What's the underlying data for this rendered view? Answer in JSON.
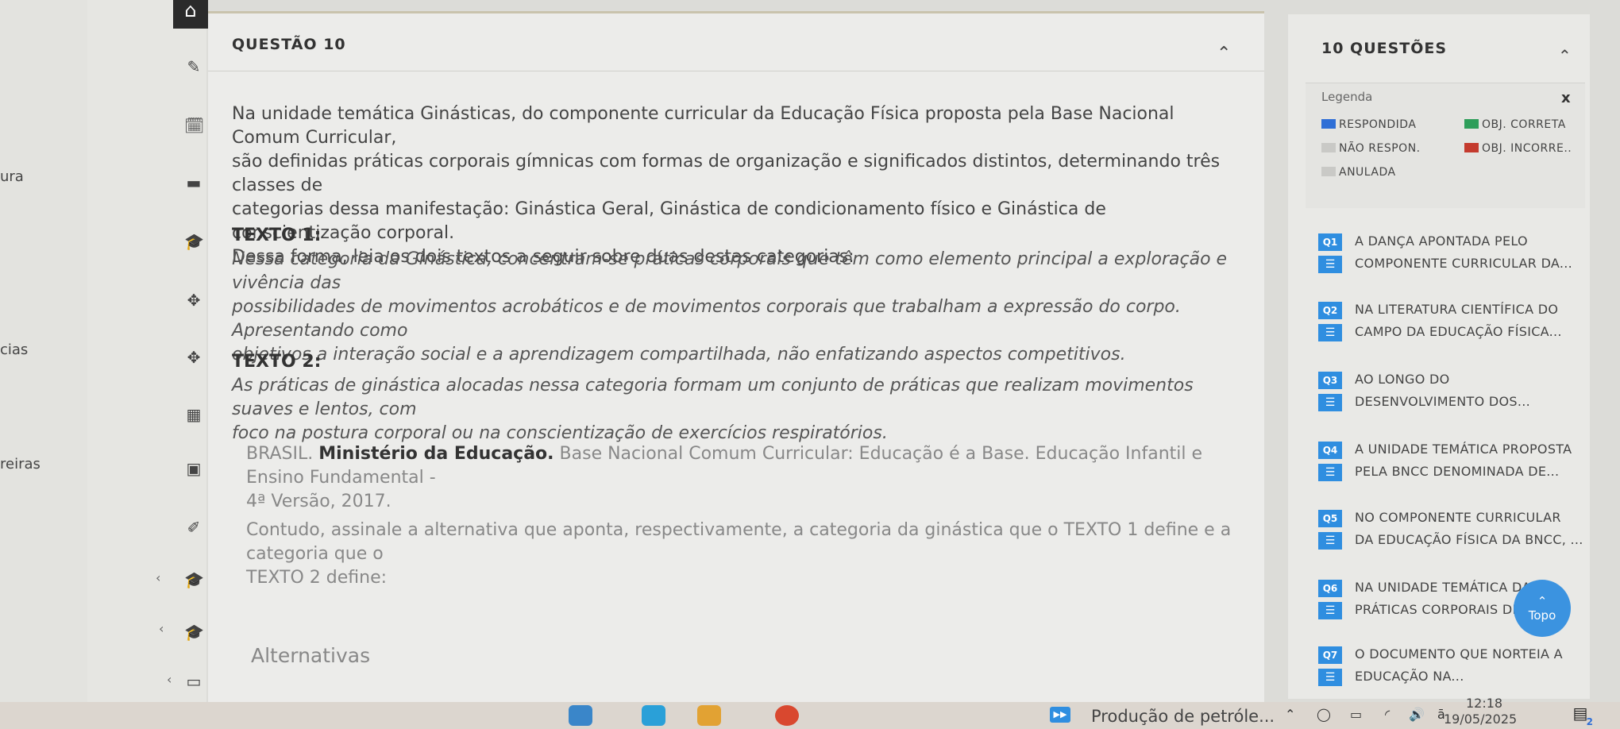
{
  "nav": {
    "labels": [
      "ura",
      "cias",
      "reiras"
    ]
  },
  "question": {
    "title": "QUESTÃO 10",
    "intro": [
      "Na unidade temática Ginásticas, do componente curricular da Educação Física proposta pela Base Nacional Comum Curricular,",
      "são definidas práticas corporais gímnicas com formas de organização e significados distintos, determinando três classes de",
      "categorias dessa manifestação: Ginástica Geral, Ginástica de condicionamento físico e Ginástica de conscientização corporal.",
      "Dessa forma, leia os dois textos a seguir sobre duas destas categorias:"
    ],
    "text1_label": "TEXTO 1:",
    "text1": [
      "Nessa categoria da Ginástica, concentram-se práticas corporais que têm como elemento principal a exploração e vivência das",
      "possibilidades de movimentos acrobáticos e de movimentos corporais que trabalham a expressão do corpo. Apresentando como",
      "objetivos a interação social e a aprendizagem compartilhada, não enfatizando aspectos competitivos."
    ],
    "text2_label": "TEXTO 2:",
    "text2": [
      "As práticas de ginástica alocadas nessa categoria formam um conjunto de práticas que realizam movimentos suaves e lentos, com",
      "foco na postura corporal ou na conscientização de exercícios respiratórios."
    ],
    "ref_a": "BRASIL.",
    "ref_b": "Ministério da Educação.",
    "ref_c": "Base Nacional Comum Curricular: Educação é a Base. Educação Infantil e Ensino Fundamental -",
    "ref_d": "4ª Versão, 2017.",
    "prompt": [
      "Contudo, assinale a alternativa que aponta, respectivamente, a categoria da ginástica que o TEXTO 1 define e a categoria que o",
      "TEXTO 2 define:"
    ],
    "alternatives_label": "Alternativas"
  },
  "panel": {
    "title": "10 QUESTÕES",
    "legend": {
      "title": "Legenda",
      "close": "x",
      "items": [
        {
          "label": "RESPONDIDA",
          "color": "#2f6fd6"
        },
        {
          "label": "OBJ. CORRETA",
          "color": "#2e9e5a"
        },
        {
          "label": "NÃO RESPON.",
          "color": "#c9c9c6"
        },
        {
          "label": "OBJ. INCORRE..",
          "color": "#c43b2e"
        },
        {
          "label": "ANULADA",
          "color": "#c9c9c6"
        }
      ]
    },
    "questions": [
      {
        "badge": "Q1",
        "line1": "A DANÇA APONTADA PELO",
        "line2": "COMPONENTE CURRICULAR DA..."
      },
      {
        "badge": "Q2",
        "line1": "NA LITERATURA CIENTÍFICA DO",
        "line2": "CAMPO DA EDUCAÇÃO FÍSICA..."
      },
      {
        "badge": "Q3",
        "line1": "AO LONGO DO",
        "line2": "DESENVOLVIMENTO DOS..."
      },
      {
        "badge": "Q4",
        "line1": "A UNIDADE TEMÁTICA PROPOSTA",
        "line2": "PELA BNCC DENOMINADA DE..."
      },
      {
        "badge": "Q5",
        "line1": "NO COMPONENTE CURRICULAR",
        "line2": "DA EDUCAÇÃO FÍSICA DA BNCC, ..."
      },
      {
        "badge": "Q6",
        "line1": "NA UNIDADE TEMÁTICA DAS",
        "line2": "PRÁTICAS CORPORAIS DE..."
      },
      {
        "badge": "Q7",
        "line1": "O DOCUMENTO QUE NORTEIA A",
        "line2": "EDUCAÇÃO NA..."
      }
    ],
    "topo_label": "Topo"
  },
  "taskbar": {
    "app_title": "Produção de petróle...",
    "time": "12:18",
    "date": "19/05/2025",
    "notif_count": "2"
  }
}
